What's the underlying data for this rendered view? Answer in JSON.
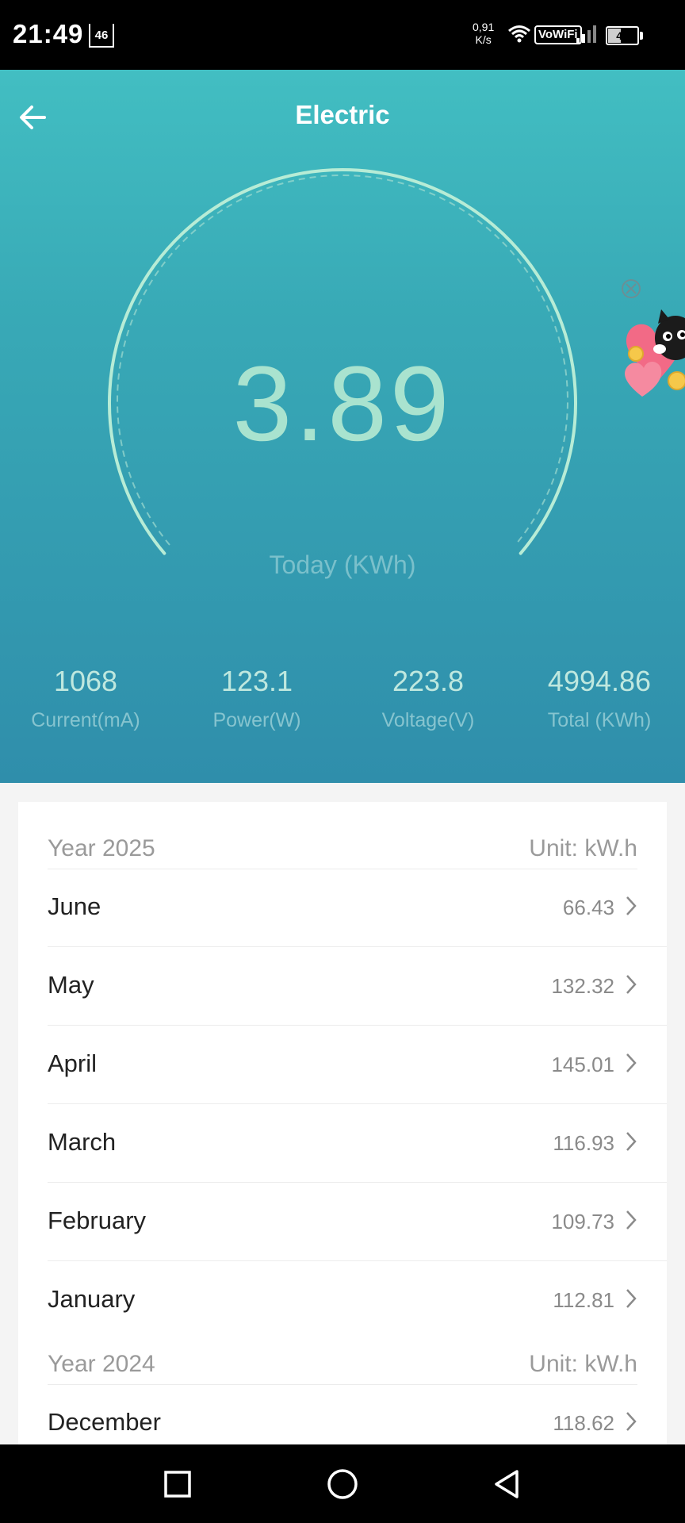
{
  "status_bar": {
    "time": "21:49",
    "network_badge": "46",
    "speed_value": "0,91",
    "speed_unit": "K/s",
    "wifi_label": "VoWiFi",
    "battery_level": "42",
    "battery_fraction": 0.42
  },
  "header": {
    "title": "Electric",
    "back_icon": "arrow-left-icon"
  },
  "gauge": {
    "value": "3.89",
    "label": "Today (KWh)"
  },
  "stats": [
    {
      "value": "1068",
      "label": "Current(mA)"
    },
    {
      "value": "123.1",
      "label": "Power(W)"
    },
    {
      "value": "223.8",
      "label": "Voltage(V)"
    },
    {
      "value": "4994.86",
      "label": "Total (KWh)"
    }
  ],
  "history": {
    "years": [
      {
        "title": "Year 2025",
        "unit": "Unit: kW.h",
        "months": [
          {
            "name": "June",
            "value": "66.43"
          },
          {
            "name": "May",
            "value": "132.32"
          },
          {
            "name": "April",
            "value": "145.01"
          },
          {
            "name": "March",
            "value": "116.93"
          },
          {
            "name": "February",
            "value": "109.73"
          },
          {
            "name": "January",
            "value": "112.81"
          }
        ]
      },
      {
        "title": "Year 2024",
        "unit": "Unit: kW.h",
        "months": [
          {
            "name": "December",
            "value": "118.62"
          }
        ]
      }
    ]
  },
  "colors": {
    "hero_top": "#42bec2",
    "hero_bottom": "#2f8eab",
    "gauge_value": "#a9e3cf"
  },
  "icons": {
    "chevron": "chevron-right-icon",
    "nav_recents": "square-icon",
    "nav_home": "circle-icon",
    "nav_back": "triangle-back-icon"
  }
}
